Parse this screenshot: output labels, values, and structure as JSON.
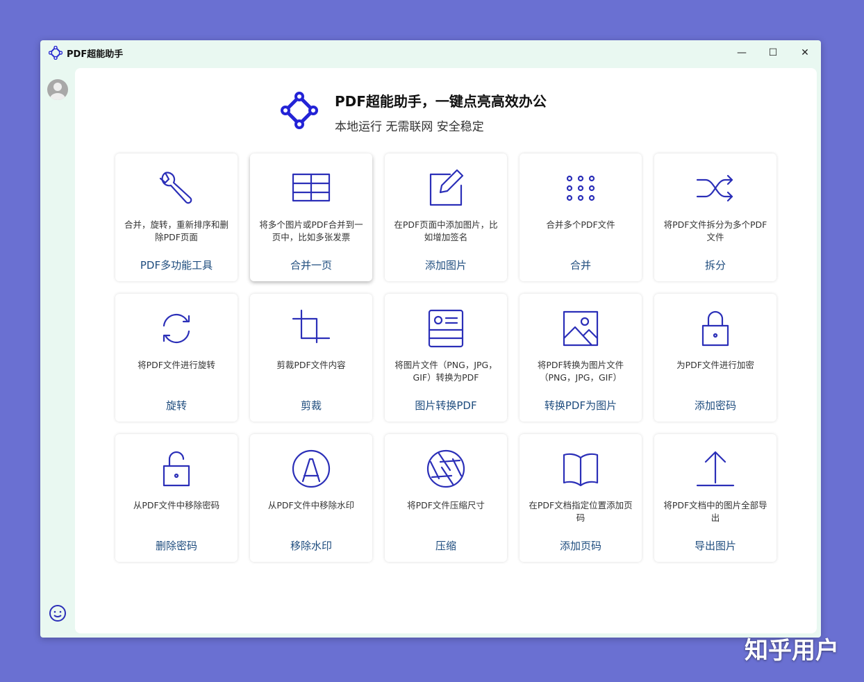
{
  "window": {
    "title": "PDF超能助手",
    "minimize": "—",
    "maximize": "☐",
    "close": "✕"
  },
  "hero": {
    "title": "PDF超能助手，一键点亮高效办公",
    "subtitle": "本地运行 无需联网 安全稳定"
  },
  "accent": "#2b2fb8",
  "tools": [
    {
      "icon": "wrench-icon",
      "desc": "合并，旋转，重新排序和删除PDF页面",
      "name": "PDF多功能工具"
    },
    {
      "icon": "grid-icon",
      "desc": "将多个图片或PDF合并到一页中，比如多张发票",
      "name": "合并一页"
    },
    {
      "icon": "edit-icon",
      "desc": "在PDF页面中添加图片，比如增加签名",
      "name": "添加图片"
    },
    {
      "icon": "dots-icon",
      "desc": "合并多个PDF文件",
      "name": "合并"
    },
    {
      "icon": "shuffle-icon",
      "desc": "将PDF文件拆分为多个PDF文件",
      "name": "拆分"
    },
    {
      "icon": "rotate-icon",
      "desc": "将PDF文件进行旋转",
      "name": "旋转"
    },
    {
      "icon": "crop-icon",
      "desc": "剪裁PDF文件内容",
      "name": "剪裁"
    },
    {
      "icon": "id-card-icon",
      "desc": "将图片文件（PNG，JPG，GIF）转换为PDF",
      "name": "图片转换PDF"
    },
    {
      "icon": "image-icon",
      "desc": "将PDF转换为图片文件（PNG，JPG，GIF）",
      "name": "转换PDF为图片"
    },
    {
      "icon": "lock-icon",
      "desc": "为PDF文件进行加密",
      "name": "添加密码"
    },
    {
      "icon": "unlock-icon",
      "desc": "从PDF文件中移除密码",
      "name": "删除密码"
    },
    {
      "icon": "watermark-icon",
      "desc": "从PDF文件中移除水印",
      "name": "移除水印"
    },
    {
      "icon": "aperture-icon",
      "desc": "将PDF文件压缩尺寸",
      "name": "压缩"
    },
    {
      "icon": "book-icon",
      "desc": "在PDF文档指定位置添加页码",
      "name": "添加页码"
    },
    {
      "icon": "upload-icon",
      "desc": "将PDF文档中的图片全部导出",
      "name": "导出图片"
    }
  ],
  "watermark": "知乎用户"
}
